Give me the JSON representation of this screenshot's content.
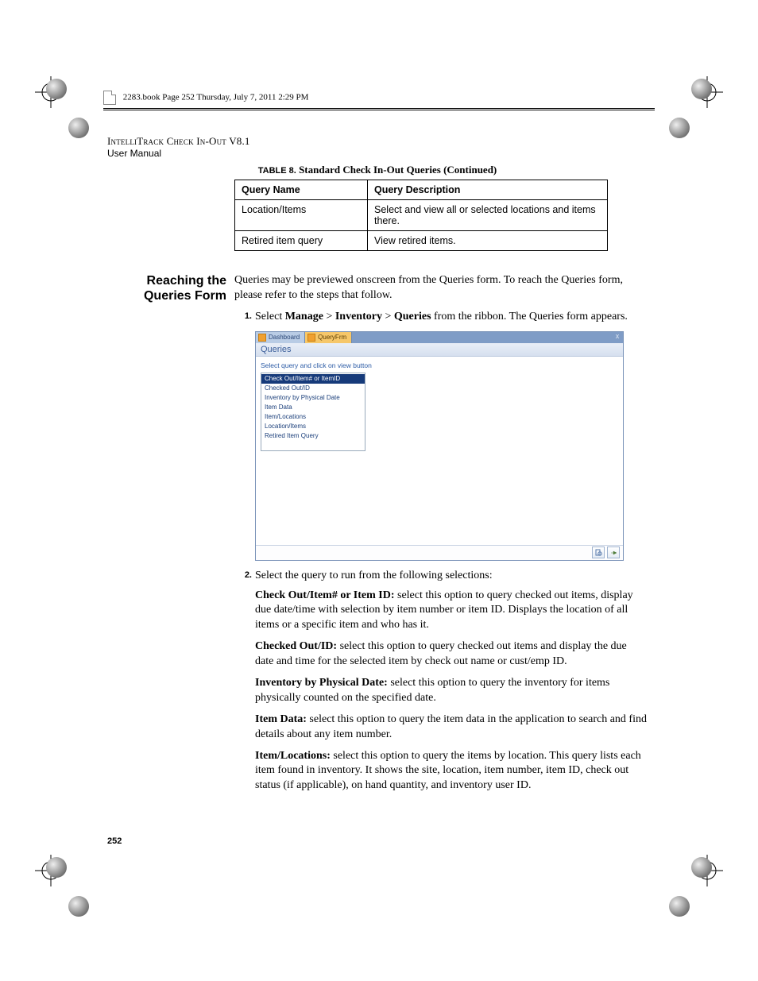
{
  "header_line": "2283.book  Page 252  Thursday, July 7, 2011  2:29 PM",
  "doc_title": "IntelliTrack Check In-Out V8.1",
  "doc_subtitle": "User Manual",
  "table": {
    "caption_label": "TABLE 8.",
    "caption_title": "Standard Check In-Out Queries (Continued)",
    "headers": [
      "Query Name",
      "Query Description"
    ],
    "rows": [
      [
        "Location/Items",
        "Select and view all or selected locations and items there."
      ],
      [
        "Retired item query",
        "View retired items."
      ]
    ]
  },
  "side_heading": "Reaching the Queries Form",
  "intro_para": "Queries may be previewed onscreen from the Queries form. To reach the Queries form, please refer to the steps that follow.",
  "step1": {
    "num": "1.",
    "pre": "Select ",
    "m1": "Manage",
    "s1": " > ",
    "m2": "Inventory",
    "s2": " > ",
    "m3": "Queries",
    "post": " from the ribbon. The Queries form appears."
  },
  "app": {
    "tab_dashboard": "Dashboard",
    "tab_query": "QueryFrm",
    "close_x": "x",
    "title": "Queries",
    "instruction": "Select query and click on view button",
    "options": [
      "Check Out/Item# or ItemID",
      "Checked Out/ID",
      "Inventory by Physical Date",
      "Item Data",
      "Item/Locations",
      "Location/Items",
      "Retired Item Query"
    ]
  },
  "step2": {
    "num": "2.",
    "text": "Select the query to run from the following selections:"
  },
  "defs": [
    {
      "b": "Check Out/Item# or Item ID:",
      "t": " select this option to query checked out items, display due date/time with selection by item number or item ID. Displays the location of all items or a specific item and who has it."
    },
    {
      "b": "Checked Out/ID:",
      "t": " select this option to query checked out items and display the due date and time for the selected item by check out name or cust/emp ID."
    },
    {
      "b": "Inventory by Physical Date:",
      "t": " select this option to query the inventory for items physically counted on the specified date."
    },
    {
      "b": "Item Data:",
      "t": " select this option to query the item data in the application to search and find details about any item number."
    },
    {
      "b": "Item/Locations:",
      "t": " select this option to query the items by location. This query lists each item found in inventory. It shows the site, location, item number, item ID, check out status (if applicable), on hand quantity, and inventory user ID."
    }
  ],
  "page_number": "252"
}
